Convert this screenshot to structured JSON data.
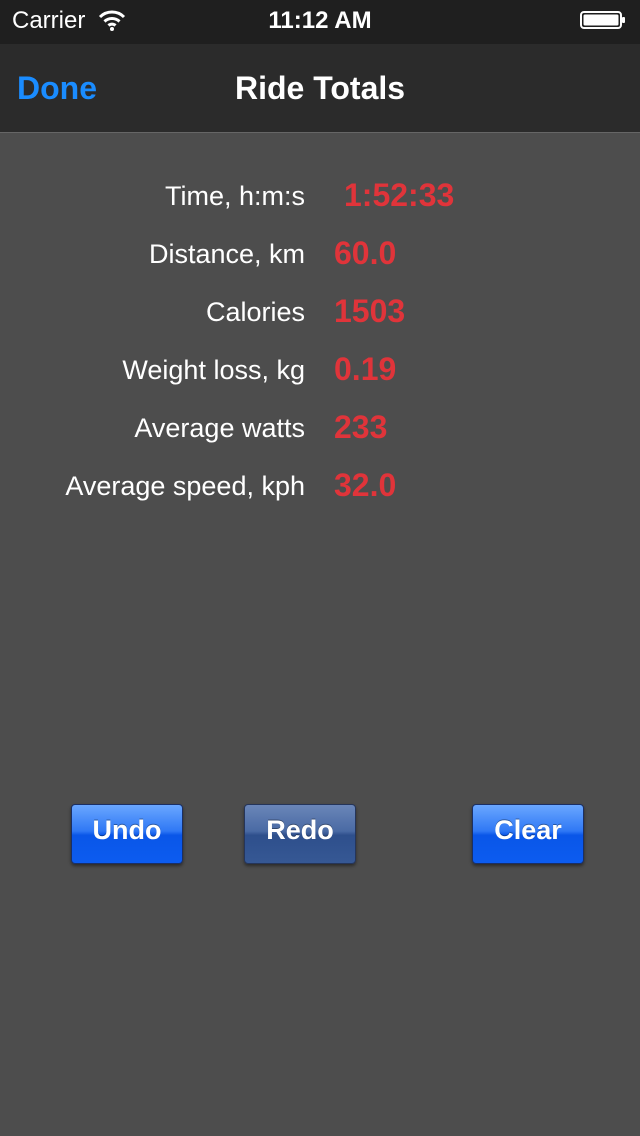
{
  "status_bar": {
    "carrier": "Carrier",
    "time": "11:12 AM"
  },
  "nav": {
    "done_label": "Done",
    "title": "Ride Totals"
  },
  "stats": [
    {
      "label": "Time, h:m:s",
      "value": "1:52:33"
    },
    {
      "label": "Distance, km",
      "value": "60.0"
    },
    {
      "label": "Calories",
      "value": "1503"
    },
    {
      "label": "Weight loss, kg",
      "value": "0.19"
    },
    {
      "label": "Average watts",
      "value": "233"
    },
    {
      "label": "Average speed, kph",
      "value": "32.0"
    }
  ],
  "buttons": {
    "undo": "Undo",
    "redo": "Redo",
    "clear": "Clear"
  },
  "colors": {
    "accent": "#1a8cff",
    "value": "#e0343a",
    "background": "#4d4d4d"
  }
}
